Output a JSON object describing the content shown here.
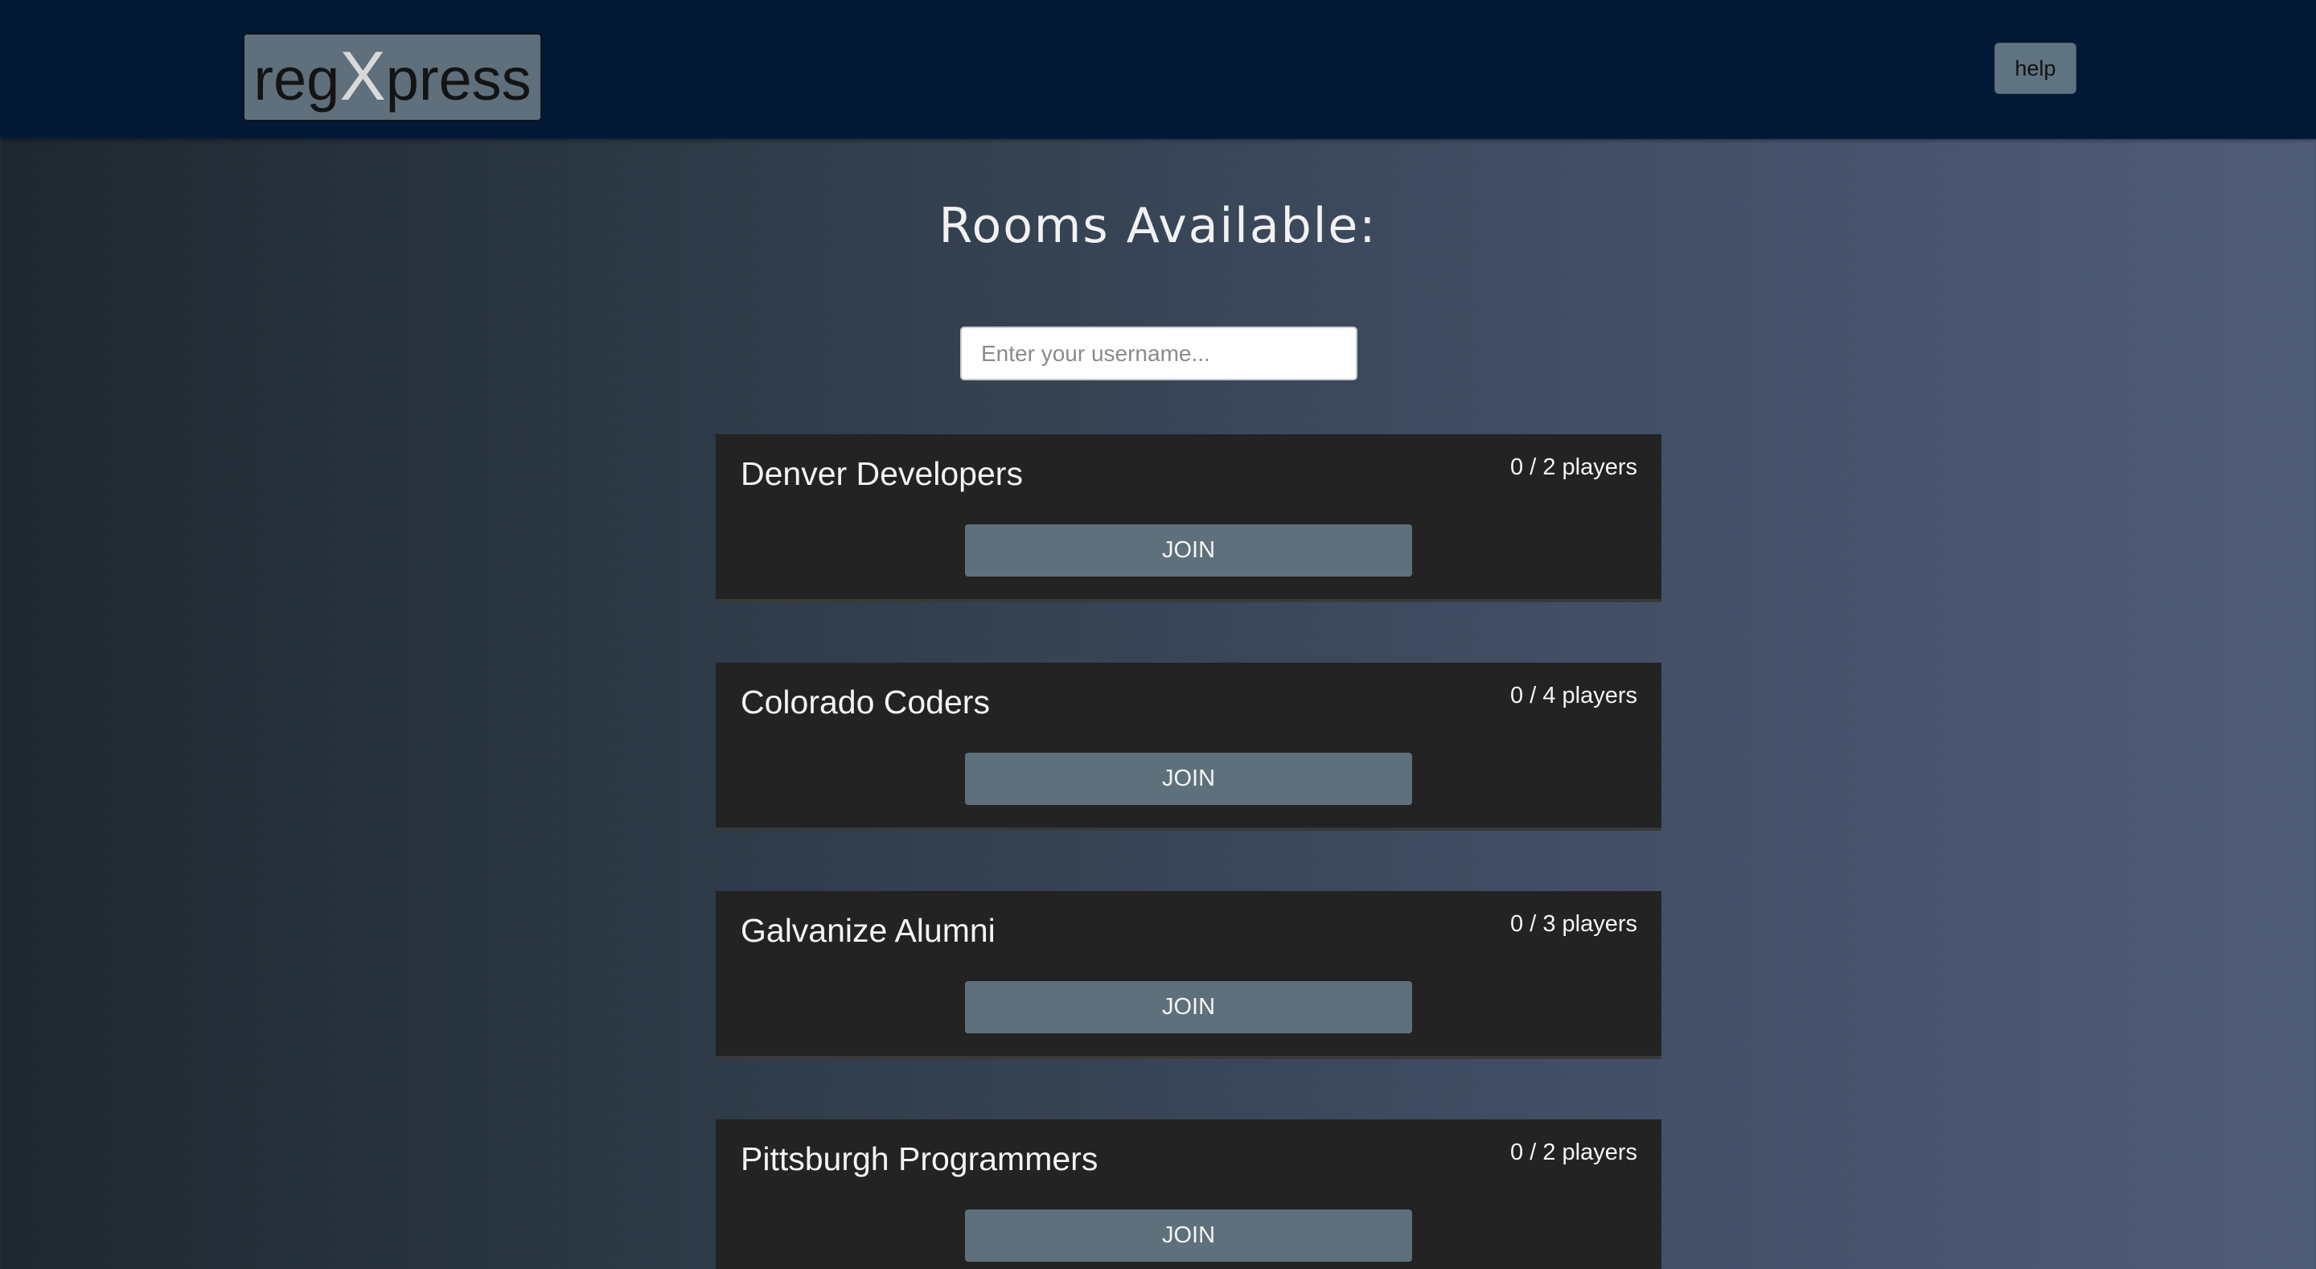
{
  "header": {
    "logo": {
      "prefix": "reg",
      "x": "X",
      "suffix": "press"
    },
    "help_label": "help"
  },
  "main": {
    "title": "Rooms Available:",
    "username_placeholder": "Enter your username..."
  },
  "rooms": [
    {
      "name": "Denver Developers",
      "players": "0 / 2 players",
      "join_label": "JOIN"
    },
    {
      "name": "Colorado Coders",
      "players": "0 / 4 players",
      "join_label": "JOIN"
    },
    {
      "name": "Galvanize Alumni",
      "players": "0 / 3 players",
      "join_label": "JOIN"
    },
    {
      "name": "Pittsburgh Programmers",
      "players": "0 / 2 players",
      "join_label": "JOIN"
    }
  ],
  "colors": {
    "header_bg": "#021936",
    "card_bg": "#232323",
    "button_bg": "#5e707c",
    "logo_bg": "#5f6f7b"
  }
}
